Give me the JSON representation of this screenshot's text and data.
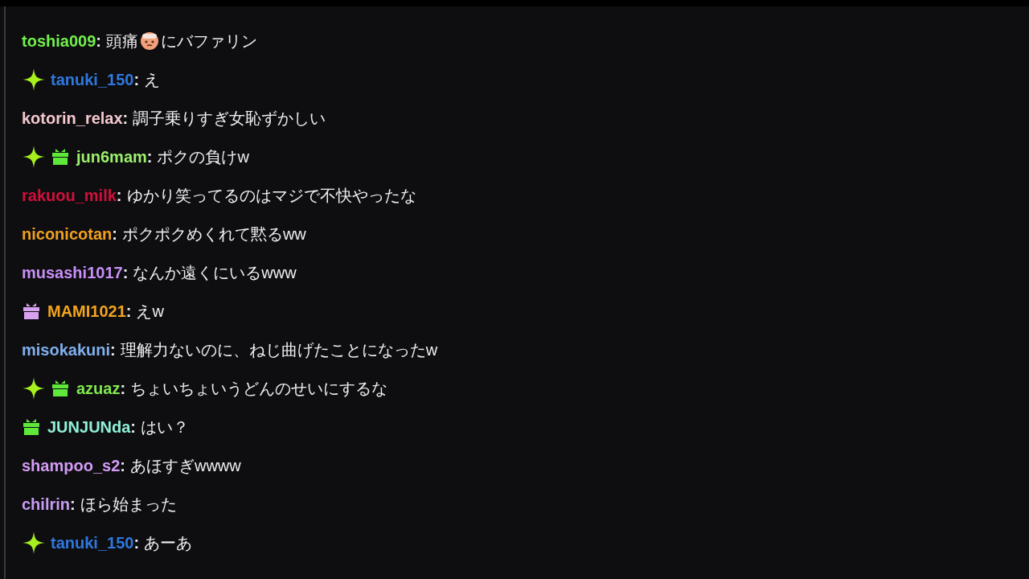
{
  "messages": [
    {
      "user": "toshia009",
      "separator": ":",
      "color": "#72f04c",
      "parts": [
        {
          "kind": "text",
          "text": "頭痛"
        },
        {
          "kind": "emote"
        },
        {
          "kind": "text",
          "text": "にバファリン"
        }
      ]
    },
    {
      "badges": [
        {
          "kind": "sparkle"
        }
      ],
      "user": "tanuki_150",
      "separator": ":",
      "color": "#2f78e0",
      "parts": [
        {
          "kind": "text",
          "text": "え"
        }
      ]
    },
    {
      "user": "kotorin_relax",
      "separator": ":",
      "color": "#f5c8d0",
      "parts": [
        {
          "kind": "text",
          "text": "調子乗りすぎ女恥ずかしい"
        }
      ]
    },
    {
      "badges": [
        {
          "kind": "sparkle"
        },
        {
          "kind": "gift",
          "color": "#5ee83a"
        }
      ],
      "user": "jun6mam",
      "separator": ":",
      "color": "#9cf06c",
      "parts": [
        {
          "kind": "text",
          "text": "ポクの負けw"
        }
      ]
    },
    {
      "user": "rakuou_milk",
      "separator": ":",
      "color": "#d0103c",
      "parts": [
        {
          "kind": "text",
          "text": "ゆかり笑ってるのはマジで不快やったな"
        }
      ]
    },
    {
      "user": "niconicotan",
      "separator": ":",
      "color": "#f0a020",
      "parts": [
        {
          "kind": "text",
          "text": "ポクポクめくれて黙るww"
        }
      ]
    },
    {
      "user": "musashi1017",
      "separator": ":",
      "color": "#c890f8",
      "parts": [
        {
          "kind": "text",
          "text": "なんか遠くにいるwww"
        }
      ]
    },
    {
      "badges": [
        {
          "kind": "gift",
          "color": "#d8a0f0"
        }
      ],
      "user": "MAMI1021",
      "separator": ":",
      "color": "#f2a41e",
      "parts": [
        {
          "kind": "text",
          "text": "えw"
        }
      ]
    },
    {
      "user": "misokakuni",
      "separator": ":",
      "color": "#80b0ee",
      "parts": [
        {
          "kind": "text",
          "text": "理解力ないのに、ねじ曲げたことになったw"
        }
      ]
    },
    {
      "badges": [
        {
          "kind": "sparkle"
        },
        {
          "kind": "gift",
          "color": "#5ee83a"
        }
      ],
      "user": "azuaz",
      "separator": ":",
      "color": "#80e84c",
      "parts": [
        {
          "kind": "text",
          "text": "ちょいちょいうどんのせいにするな"
        }
      ]
    },
    {
      "badges": [
        {
          "kind": "gift",
          "color": "#5ee83a"
        }
      ],
      "user": "JUNJUNda",
      "separator": ":",
      "color": "#90f0d8",
      "parts": [
        {
          "kind": "text",
          "text": "はい？"
        }
      ]
    },
    {
      "user": "shampoo_s2",
      "separator": ":",
      "color": "#d49cf6",
      "parts": [
        {
          "kind": "text",
          "text": "あほすぎwwww"
        }
      ]
    },
    {
      "user": "chilrin",
      "separator": ":",
      "color": "#c89cf2",
      "parts": [
        {
          "kind": "text",
          "text": "ほら始まった"
        }
      ]
    },
    {
      "badges": [
        {
          "kind": "sparkle"
        }
      ],
      "user": "tanuki_150",
      "separator": ":",
      "color": "#2f78e0",
      "parts": [
        {
          "kind": "text",
          "text": "あーあ"
        }
      ]
    }
  ]
}
